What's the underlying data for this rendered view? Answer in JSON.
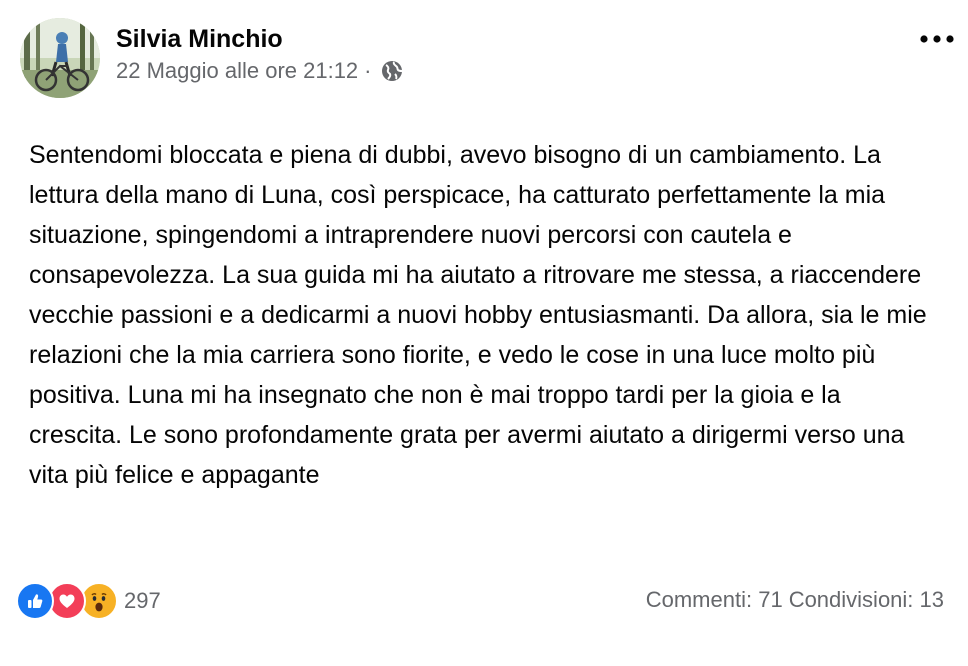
{
  "post": {
    "author": "Silvia Minchio",
    "timestamp": "22 Maggio alle ore 21:12",
    "separator": "·",
    "privacy_icon": "globe-icon",
    "more_icon": "more-options-icon",
    "text": "Sentendomi bloccata e piena di dubbi, avevo bisogno di un cambiamento. La lettura della mano di Luna, così perspicace, ha catturato perfettamente la mia situazione, spingendomi a intraprendere nuovi percorsi con cautela e consapevolezza. La sua guida mi ha aiutato a ritrovare me stessa, a riaccendere vecchie passioni e a dedicarmi a nuovi hobby entusiasmanti. Da allora, sia le mie relazioni che la mia carriera sono fiorite, e vedo le cose in una luce molto più positiva. Luna mi ha insegnato che non è mai troppo tardi per la gioia e la crescita. Le sono profondamente grata per avermi aiutato a dirigermi verso una vita più felice e appagante"
  },
  "footer": {
    "reactions": [
      "like-icon",
      "love-icon",
      "wow-icon"
    ],
    "reaction_count": "297",
    "comments": "Commenti: 71",
    "shares": "Condivisioni: 13"
  },
  "colors": {
    "text": "#050505",
    "secondary": "#65676b",
    "like": "#1877f2",
    "love": "#f33e58",
    "wow": "#f7b125"
  }
}
